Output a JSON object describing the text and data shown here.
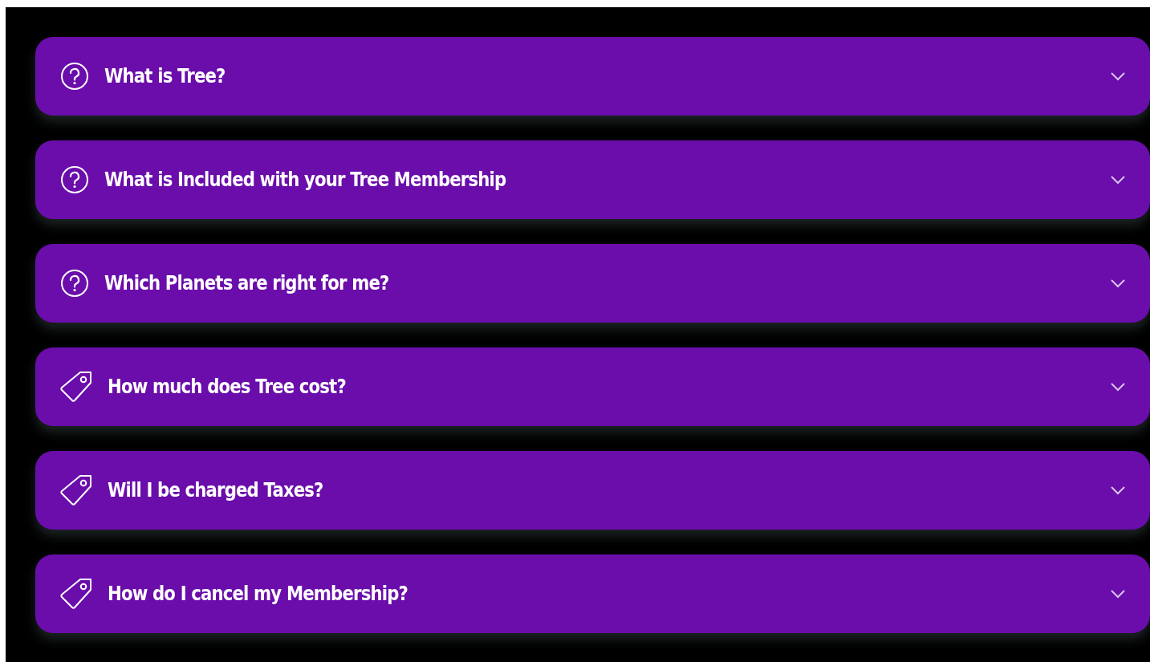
{
  "faq": [
    {
      "kind": "question",
      "title": "What is Tree?",
      "expanded": false
    },
    {
      "kind": "question",
      "title": "What is Included with your Tree Membership",
      "expanded": false
    },
    {
      "kind": "question",
      "title": "Which Planets are right for me?",
      "expanded": false
    },
    {
      "kind": "price",
      "title": "How much does Tree cost?",
      "expanded": false
    },
    {
      "kind": "price",
      "title": "Will I be charged Taxes?",
      "expanded": false
    },
    {
      "kind": "price",
      "title": "How do I cancel my Membership?",
      "expanded": false
    }
  ]
}
